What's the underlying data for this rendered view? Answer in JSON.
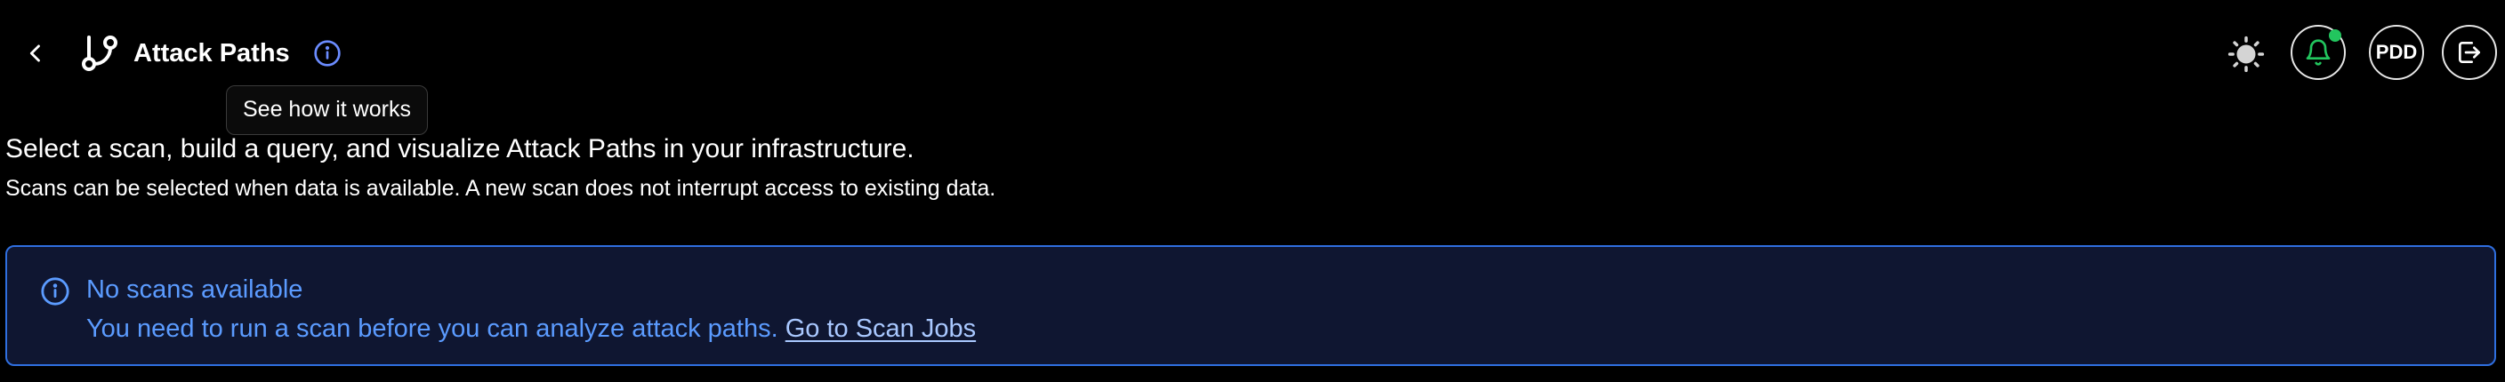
{
  "header": {
    "title": "Attack Paths",
    "back_icon": "chevron-left-icon",
    "app_icon": "git-branch-icon",
    "info_icon": "info-circle-icon",
    "tooltip": "See how it works",
    "theme_icon": "sun-icon",
    "notification_icon": "bell-icon",
    "notification_badge_color": "#22c55e",
    "user_initials": "PDD",
    "logout_icon": "logout-icon"
  },
  "main": {
    "subtitle": "Select a scan, build a query, and visualize Attack Paths in your infrastructure.",
    "description": "Scans can be selected when data is available. A new scan does not interrupt access to existing data."
  },
  "alert": {
    "icon": "info-circle-icon",
    "title": "No scans available",
    "message": "You need to run a scan before you can analyze attack paths.",
    "link_label": "Go to Scan Jobs",
    "accent_color": "#5b9bff",
    "border_color": "#2f6fe0",
    "background_color": "#0f1631"
  }
}
